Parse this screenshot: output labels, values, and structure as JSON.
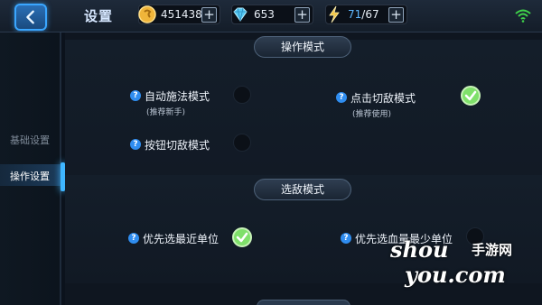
{
  "header": {
    "title": "设置",
    "back_icon": "chevron-left-icon",
    "gold": "451438",
    "diamond": "653",
    "energy_current": "71",
    "energy_max": "/67",
    "plus": "+",
    "wifi_icon": "wifi-icon"
  },
  "sidebar": {
    "items": [
      {
        "label": "基础设置"
      },
      {
        "label": "操作设置"
      }
    ]
  },
  "sections": [
    {
      "title": "操作模式",
      "options": [
        {
          "label": "自动施法模式",
          "sub": "(推荐新手)",
          "checked": false
        },
        {
          "label": "点击切敌模式",
          "sub": "(推荐使用)",
          "checked": true
        },
        {
          "label": "按钮切敌模式",
          "sub": "",
          "checked": false
        }
      ]
    },
    {
      "title": "选敌模式",
      "options": [
        {
          "label": "优先选最近单位",
          "checked": true
        },
        {
          "label": "优先选血量最少单位",
          "checked": false
        }
      ]
    }
  ],
  "help_mark": "?",
  "watermark": {
    "main": "shou",
    "cn": "手游网",
    "sub": "you.com"
  },
  "colors": {
    "accent": "#3aa6ff",
    "check": "#7fe06a",
    "background": "#0f1620"
  }
}
